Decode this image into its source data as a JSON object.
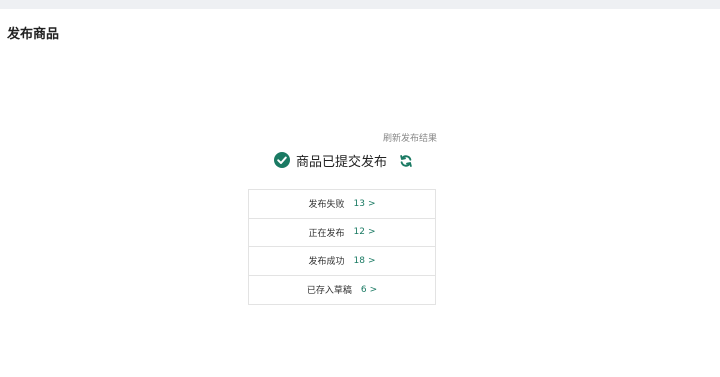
{
  "page": {
    "title": "发布商品"
  },
  "result": {
    "refresh_hint": "刷新发布结果",
    "status_text": "商品已提交发布",
    "icons": {
      "status": "check-circle-icon",
      "refresh": "refresh-icon"
    },
    "accent_color": "#1a7a63",
    "rows": [
      {
        "label": "发布失败",
        "count": "13",
        "arrow": ">"
      },
      {
        "label": "正在发布",
        "count": "12",
        "arrow": ">"
      },
      {
        "label": "发布成功",
        "count": "18",
        "arrow": ">"
      },
      {
        "label": "已存入草稿",
        "count": "6",
        "arrow": ">"
      }
    ]
  }
}
